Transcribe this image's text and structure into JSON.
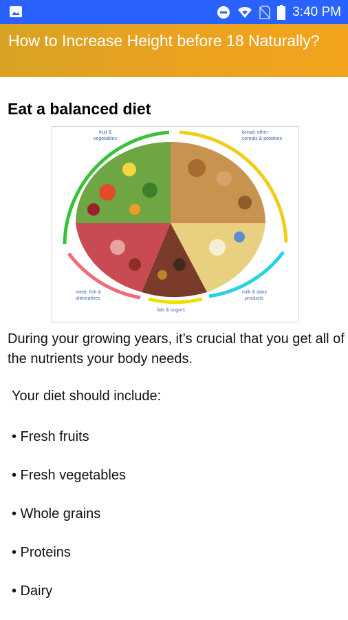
{
  "status_bar": {
    "time": "3:40 PM",
    "icons": [
      "image-icon",
      "dnd-icon",
      "wifi-icon",
      "no-sim-icon",
      "battery-icon"
    ]
  },
  "app_bar": {
    "title": "How to Increase Height before 18 Naturally?",
    "gradient_colors": [
      "#d9a223",
      "#f2a41d"
    ]
  },
  "article": {
    "heading": "Eat a balanced diet",
    "figure": {
      "labels": {
        "fruit": "fruit & vegetables",
        "bread": "bread, other cereals & potatoes",
        "meat": "meat, fish & alternatives",
        "fats": "fats & sugars",
        "milk": "milk & dairy products"
      }
    },
    "paragraph": "During your growing years, it’s crucial that you get all of the nutrients your body needs.",
    "diet_title": "Your diet should include:",
    "list": [
      "• Fresh fruits",
      "• Fresh vegetables",
      "• Whole grains",
      "• Proteins",
      "• Dairy"
    ]
  }
}
